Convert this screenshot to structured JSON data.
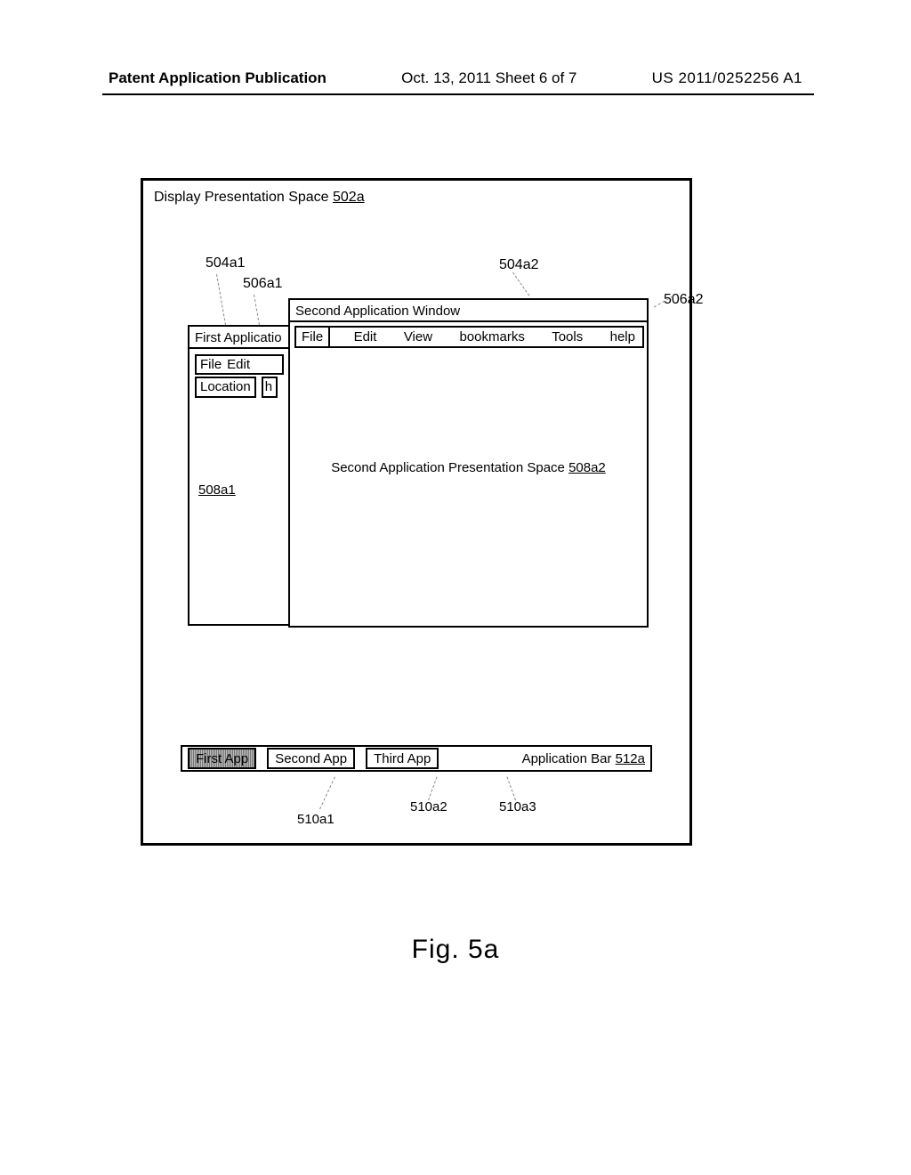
{
  "header": {
    "left": "Patent Application Publication",
    "center": "Oct. 13, 2011  Sheet 6 of 7",
    "right": "US 2011/0252256 A1"
  },
  "display_space": {
    "title_prefix": "Display Presentation Space ",
    "title_ref": "502a"
  },
  "callouts": {
    "c504a1": "504a1",
    "c506a1": "506a1",
    "c504a2": "504a2",
    "c506a2": "506a2",
    "c510a1": "510a1",
    "c510a2": "510a2",
    "c510a3": "510a3"
  },
  "first_window": {
    "title": "First Applicatio",
    "menu": {
      "file": "File",
      "edit": "Edit",
      "location": "Location",
      "url_trunc": "h"
    },
    "space_ref": "508a1"
  },
  "second_window": {
    "title": "Second Application Window",
    "menu": {
      "file": "File",
      "edit": "Edit",
      "view": "View",
      "bookmarks": "bookmarks",
      "tools": "Tools",
      "help": "help"
    },
    "content_prefix": "Second Application Presentation Space ",
    "content_ref": "508a2"
  },
  "app_bar": {
    "tasks": [
      {
        "label": "First App"
      },
      {
        "label": "Second App"
      },
      {
        "label": "Third App"
      }
    ],
    "label_prefix": "Application Bar ",
    "label_ref": "512a"
  },
  "figure_caption": "Fig.  5a"
}
